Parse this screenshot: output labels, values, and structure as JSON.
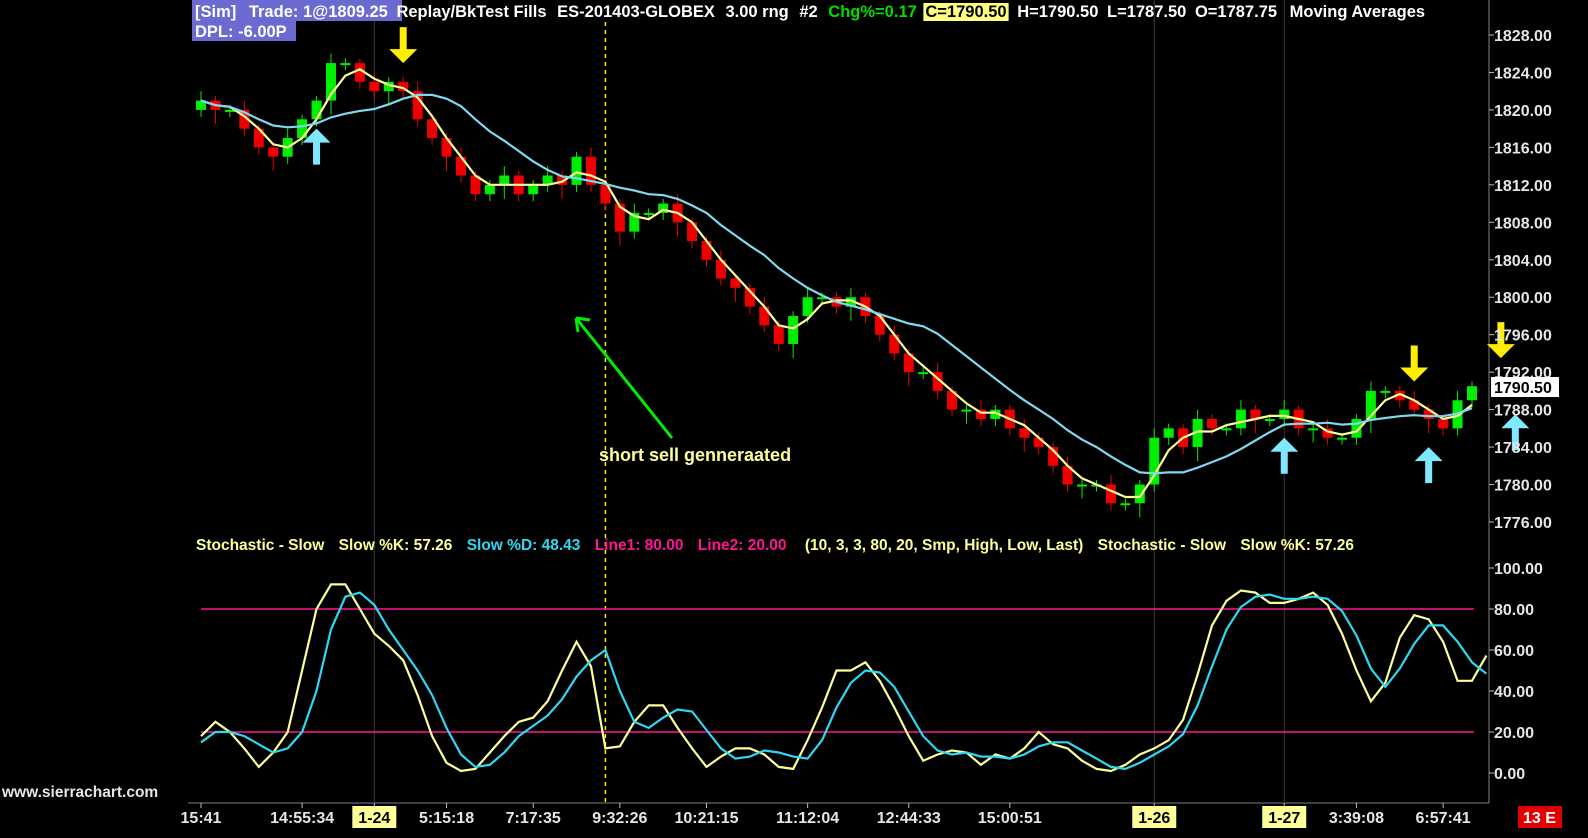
{
  "header": {
    "sim": "[Sim]",
    "trade": "Trade: 1@1809.25",
    "mode": "Replay/BkTest Fills",
    "symbol": "ES-201403-GLOBEX",
    "range": "3.00 rng",
    "chart_no": "#2",
    "chg": "Chg%=0.17",
    "close": "C=1790.50",
    "high": "H=1790.50",
    "low": "L=1787.50",
    "open": "O=1787.75",
    "study": "Moving Averages",
    "dpl": "DPL: -6.00P"
  },
  "stoch_header": {
    "name": "Stochastic - Slow",
    "k": "Slow %K: 57.26",
    "d": "Slow %D: 48.43",
    "line1": "Line1: 80.00",
    "line2": "Line2: 20.00",
    "params": "(10, 3, 3, 80, 20, Smp, High, Low, Last)",
    "name2": "Stochastic - Slow",
    "k2": "Slow %K: 57.26"
  },
  "annotation": "short sell genneraated",
  "last_price_label": "1790.50",
  "bottom_right_badge": "13 E",
  "website": "www.sierrachart.com",
  "colors": {
    "bull": "#00ee00",
    "bear": "#ee0000",
    "fast_ma": "#ffff99",
    "slow_ma": "#80d8f0",
    "stoch_k": "#ffff99",
    "stoch_d": "#2ed8f0",
    "stoch_lines": "#ff1493",
    "buy_arrow": "#7fe8ff",
    "sell_arrow": "#ffee00",
    "annotation_arrow": "#00ee00"
  },
  "chart_data": [
    {
      "type": "candlestick",
      "title": "ES-201403-GLOBEX 3.00 rng",
      "ylim": [
        1774,
        1830
      ],
      "y_ticks": [
        "1828.00",
        "1824.00",
        "1820.00",
        "1816.00",
        "1812.00",
        "1808.00",
        "1804.00",
        "1800.00",
        "1796.00",
        "1792.00",
        "1788.00",
        "1784.00",
        "1780.00",
        "1776.00"
      ],
      "x_ticks": [
        {
          "label": "15:41",
          "bar": 0
        },
        {
          "label": "14:55:34",
          "bar": 7
        },
        {
          "label": "1-24",
          "bar": 12,
          "highlight": true
        },
        {
          "label": "5:15:18",
          "bar": 17
        },
        {
          "label": "7:17:35",
          "bar": 23
        },
        {
          "label": "9:32:26",
          "bar": 29
        },
        {
          "label": "10:21:15",
          "bar": 35
        },
        {
          "label": "11:12:04",
          "bar": 42
        },
        {
          "label": "12:44:33",
          "bar": 49
        },
        {
          "label": "15:00:51",
          "bar": 56
        },
        {
          "label": "1-26",
          "bar": 66,
          "highlight": true
        },
        {
          "label": "1-27",
          "bar": 75,
          "highlight": true
        },
        {
          "label": "3:39:08",
          "bar": 80
        },
        {
          "label": "6:57:41",
          "bar": 86
        }
      ],
      "closes": [
        1821,
        1820,
        1820,
        1818,
        1816,
        1815,
        1817,
        1819,
        1821,
        1825,
        1825,
        1823,
        1822,
        1823,
        1822,
        1819,
        1817,
        1815,
        1813,
        1811,
        1812,
        1813,
        1811,
        1812,
        1813,
        1812,
        1815,
        1812,
        1810,
        1807,
        1809,
        1809,
        1810,
        1808,
        1806,
        1804,
        1802,
        1801,
        1799,
        1797,
        1795,
        1798,
        1800,
        1800,
        1799,
        1800,
        1798,
        1796,
        1794,
        1792,
        1792,
        1790,
        1788,
        1788,
        1787,
        1788,
        1786,
        1785,
        1784,
        1782,
        1780,
        1780,
        1780,
        1778,
        1778,
        1780,
        1785,
        1786,
        1784,
        1787,
        1786,
        1786,
        1788,
        1787,
        1787,
        1788,
        1786,
        1786,
        1785,
        1785,
        1787,
        1790,
        1790,
        1789,
        1788,
        1787,
        1786,
        1789,
        1790.5
      ],
      "moving_averages": [
        {
          "name": "fast",
          "period": 3
        },
        {
          "name": "slow",
          "period": 10
        }
      ],
      "signals": [
        {
          "bar": 8,
          "type": "buy"
        },
        {
          "bar": 14,
          "type": "sell"
        },
        {
          "bar": 75,
          "type": "buy"
        },
        {
          "bar": 84,
          "type": "sell"
        },
        {
          "bar": 85,
          "type": "buy"
        },
        {
          "bar": 90,
          "type": "sell"
        },
        {
          "bar": 91,
          "type": "buy"
        }
      ],
      "vertical_marker_bar": 28
    },
    {
      "type": "line",
      "title": "Stochastic - Slow",
      "ylim": [
        -6,
        106
      ],
      "y_ticks": [
        "100.00",
        "80.00",
        "60.00",
        "40.00",
        "20.00",
        "0.00"
      ],
      "hlines": [
        80,
        20
      ],
      "series": [
        {
          "name": "Slow %K",
          "values": [
            18,
            25,
            20,
            12,
            3,
            10,
            20,
            50,
            80,
            92,
            92,
            80,
            68,
            62,
            55,
            38,
            18,
            5,
            1,
            2,
            10,
            18,
            25,
            27,
            35,
            50,
            64,
            52,
            12,
            13,
            25,
            33,
            33,
            22,
            12,
            3,
            8,
            12,
            12,
            9,
            3,
            2,
            16,
            32,
            50,
            50,
            54,
            45,
            32,
            18,
            6,
            9,
            11,
            10,
            4,
            9,
            7,
            12,
            20,
            14,
            12,
            6,
            2,
            1,
            4,
            9,
            12,
            16,
            26,
            48,
            72,
            84,
            89,
            88,
            83,
            83,
            85,
            88,
            82,
            68,
            50,
            35,
            44,
            66,
            77,
            75,
            64,
            45,
            45,
            57.26
          ]
        },
        {
          "name": "Slow %D",
          "values": [
            15,
            20,
            20,
            18,
            14,
            10,
            12,
            20,
            40,
            70,
            86,
            88,
            82,
            70,
            60,
            50,
            38,
            22,
            9,
            3,
            4,
            10,
            18,
            23,
            28,
            36,
            47,
            55,
            60,
            40,
            25,
            22,
            27,
            31,
            30,
            21,
            12,
            7,
            8,
            11,
            10,
            8,
            7,
            16,
            32,
            44,
            50,
            49,
            42,
            30,
            18,
            11,
            9,
            10,
            8,
            8,
            7,
            9,
            13,
            15,
            15,
            11,
            7,
            3,
            2,
            5,
            9,
            13,
            19,
            33,
            52,
            70,
            81,
            86,
            87,
            85,
            85,
            86,
            85,
            79,
            67,
            51,
            42,
            51,
            63,
            72,
            72,
            64,
            54,
            48.43
          ]
        }
      ]
    }
  ]
}
